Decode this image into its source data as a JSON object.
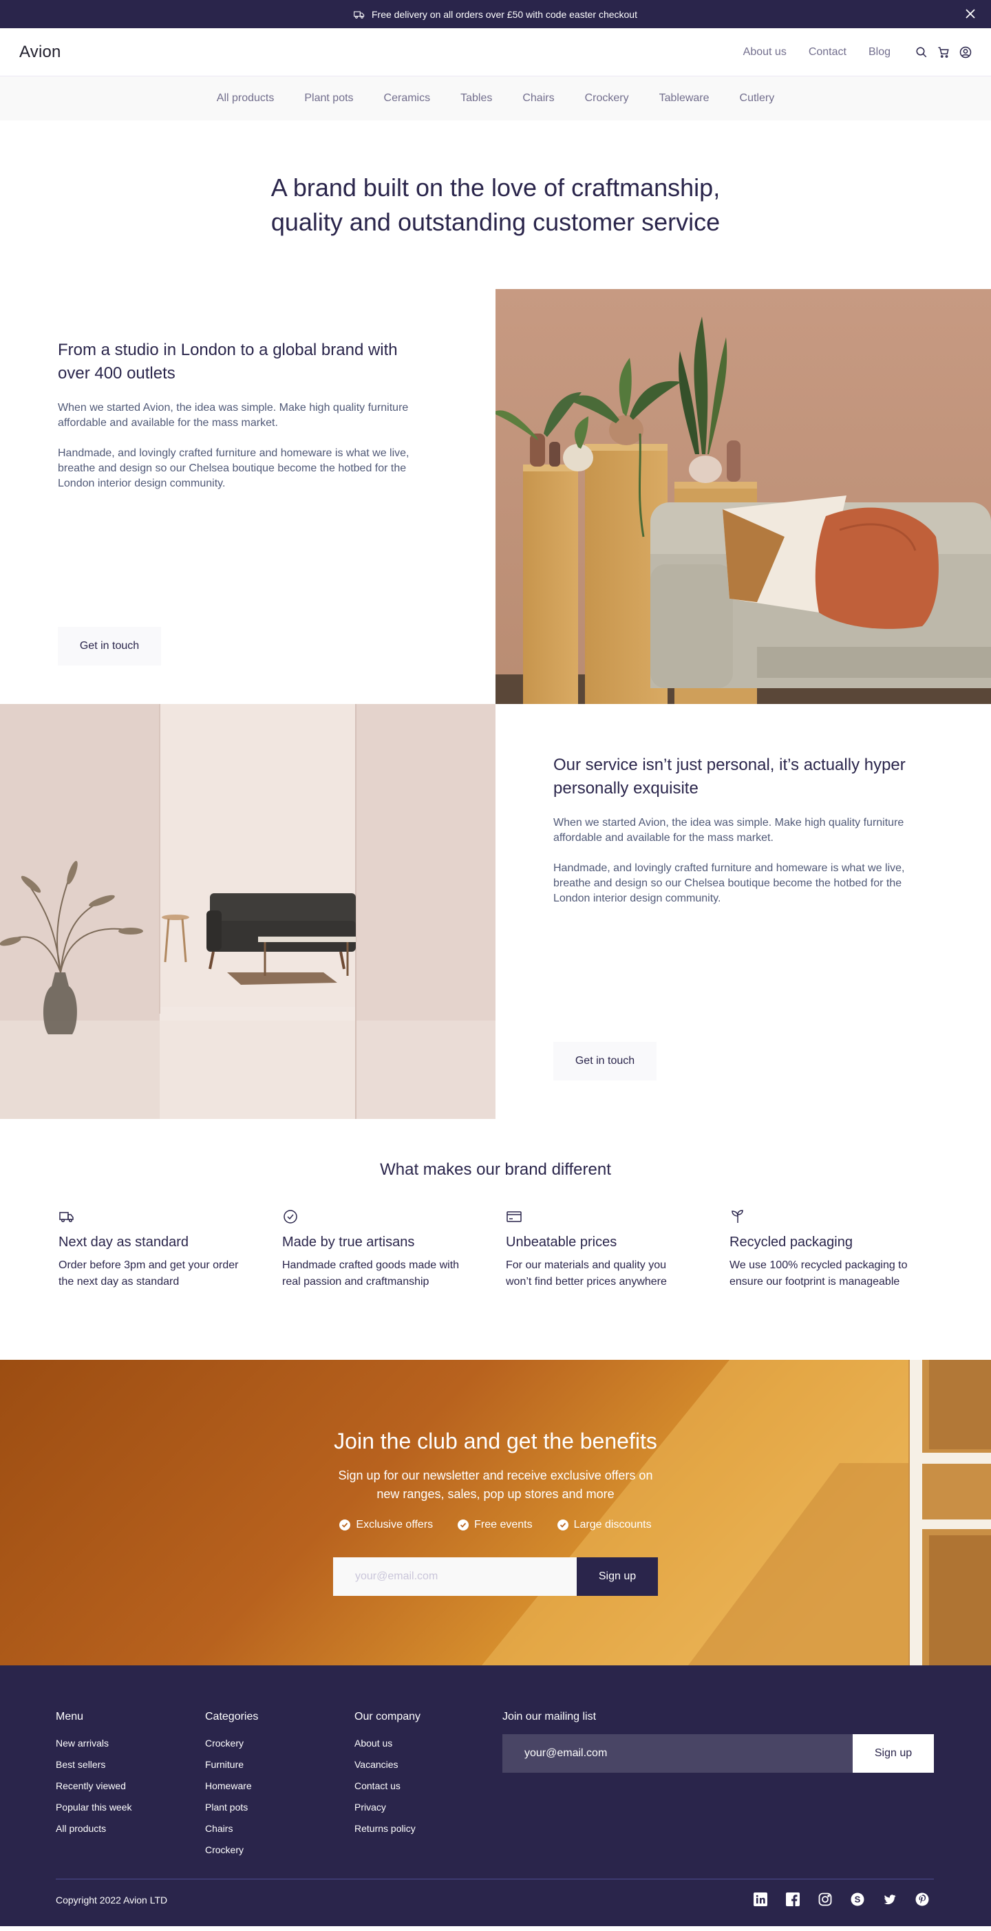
{
  "announcement": {
    "text": "Free delivery on all orders over £50 with code easter checkout",
    "icons": {
      "left": "truck-icon",
      "right": "close-icon"
    }
  },
  "header": {
    "logo": "Avion",
    "links": [
      "About us",
      "Contact",
      "Blog"
    ],
    "icons": [
      "search-icon",
      "cart-icon",
      "user-icon"
    ]
  },
  "categories": [
    "All products",
    "Plant pots",
    "Ceramics",
    "Tables",
    "Chairs",
    "Crockery",
    "Tableware",
    "Cutlery"
  ],
  "hero": {
    "title": "A brand built on the love of craftmanship, quality and outstanding customer service"
  },
  "section1": {
    "title": "From a studio in London to a global brand with over 400 outlets",
    "para1": "When we started Avion, the idea was simple. Make high quality furniture affordable and available for the mass market.",
    "para2": "Handmade, and lovingly crafted furniture and homeware is what we live, breathe and design so our Chelsea boutique become the hotbed for the London interior design community.",
    "button": "Get in touch"
  },
  "section2": {
    "title": "Our service isn’t just personal, it’s actually hyper personally exquisite",
    "para1": "When we started Avion, the idea was simple. Make high quality furniture affordable and available for the mass market.",
    "para2": "Handmade, and lovingly crafted furniture and homeware is what we live, breathe and design so our Chelsea boutique become the hotbed for the London interior design community.",
    "button": "Get in touch"
  },
  "different": {
    "title": "What makes our brand different",
    "features": [
      {
        "icon": "delivery-truck-icon",
        "title": "Next day as standard",
        "text": "Order before 3pm and get your order the next day as standard"
      },
      {
        "icon": "checkmark-circle-icon",
        "title": "Made by true artisans",
        "text": "Handmade crafted goods made with real passion and craftmanship"
      },
      {
        "icon": "credit-card-icon",
        "title": "Unbeatable prices",
        "text": "For our materials and quality you won’t find better prices anywhere"
      },
      {
        "icon": "sprout-icon",
        "title": "Recycled packaging",
        "text": "We use 100% recycled packaging to ensure our footprint is manageable"
      }
    ]
  },
  "club": {
    "title": "Join the club and get the benefits",
    "subtitle": "Sign up for our newsletter and receive exclusive offers on new ranges, sales, pop up stores and more",
    "perks": [
      "Exclusive offers",
      "Free events",
      "Large discounts"
    ],
    "email_placeholder": "your@email.com",
    "button": "Sign up"
  },
  "footer": {
    "menu": {
      "title": "Menu",
      "items": [
        "New arrivals",
        "Best sellers",
        "Recently viewed",
        "Popular this week",
        "All products"
      ]
    },
    "categories": {
      "title": "Categories",
      "items": [
        "Crockery",
        "Furniture",
        "Homeware",
        "Plant pots",
        "Chairs",
        "Crockery"
      ]
    },
    "company": {
      "title": "Our company",
      "items": [
        "About us",
        "Vacancies",
        "Contact us",
        "Privacy",
        "Returns policy"
      ]
    },
    "mailing": {
      "title": "Join our mailing list",
      "placeholder": "your@email.com",
      "button": "Sign up"
    },
    "copyright": "Copyright 2022 Avion LTD",
    "socials": [
      "linkedin-icon",
      "facebook-icon",
      "instagram-icon",
      "skype-icon",
      "twitter-icon",
      "pinterest-icon"
    ]
  },
  "colors": {
    "primary": "#2A254B",
    "muted_text": "#726E8D",
    "light_bg": "#F9F9F9",
    "club_orange": "#B8621E"
  }
}
